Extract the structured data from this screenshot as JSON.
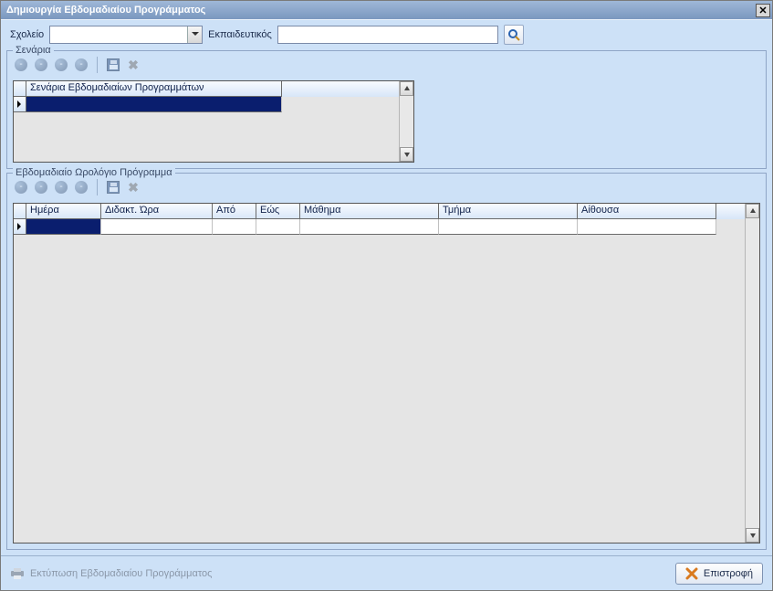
{
  "window": {
    "title": "Δημιουργία Εβδομαδιαίου Προγράμματος"
  },
  "filters": {
    "school_label": "Σχολείο",
    "school_value": "",
    "teacher_label": "Εκπαιδευτικός",
    "teacher_value": ""
  },
  "icons": {
    "search": "search-icon",
    "close": "close-icon"
  },
  "scenarios": {
    "legend": "Σενάρια",
    "header": "Σενάρια Εβδομαδιαίων Προγραμμάτων",
    "rows": [
      {
        "name": ""
      }
    ]
  },
  "schedule": {
    "legend": "Εβδομαδιαίο Ωρολόγιο Πρόγραμμα",
    "columns": {
      "day": "Ημέρα",
      "period": "Διδακτ. Ώρα",
      "from": "Από",
      "to": "Εώς",
      "subject": "Μάθημα",
      "section": "Τμήμα",
      "room": "Αίθουσα"
    },
    "rows": [
      {
        "day": "",
        "period": "",
        "from": "",
        "to": "",
        "subject": "",
        "section": "",
        "room": ""
      }
    ]
  },
  "footer": {
    "print_label": "Εκτύπωση Εβδομαδιαίου Προγράμματος",
    "return_label": "Επιστροφή"
  },
  "toolbar": {
    "first": "first",
    "prev": "prev",
    "next": "next",
    "last": "last",
    "save": "save",
    "cancel": "cancel"
  }
}
